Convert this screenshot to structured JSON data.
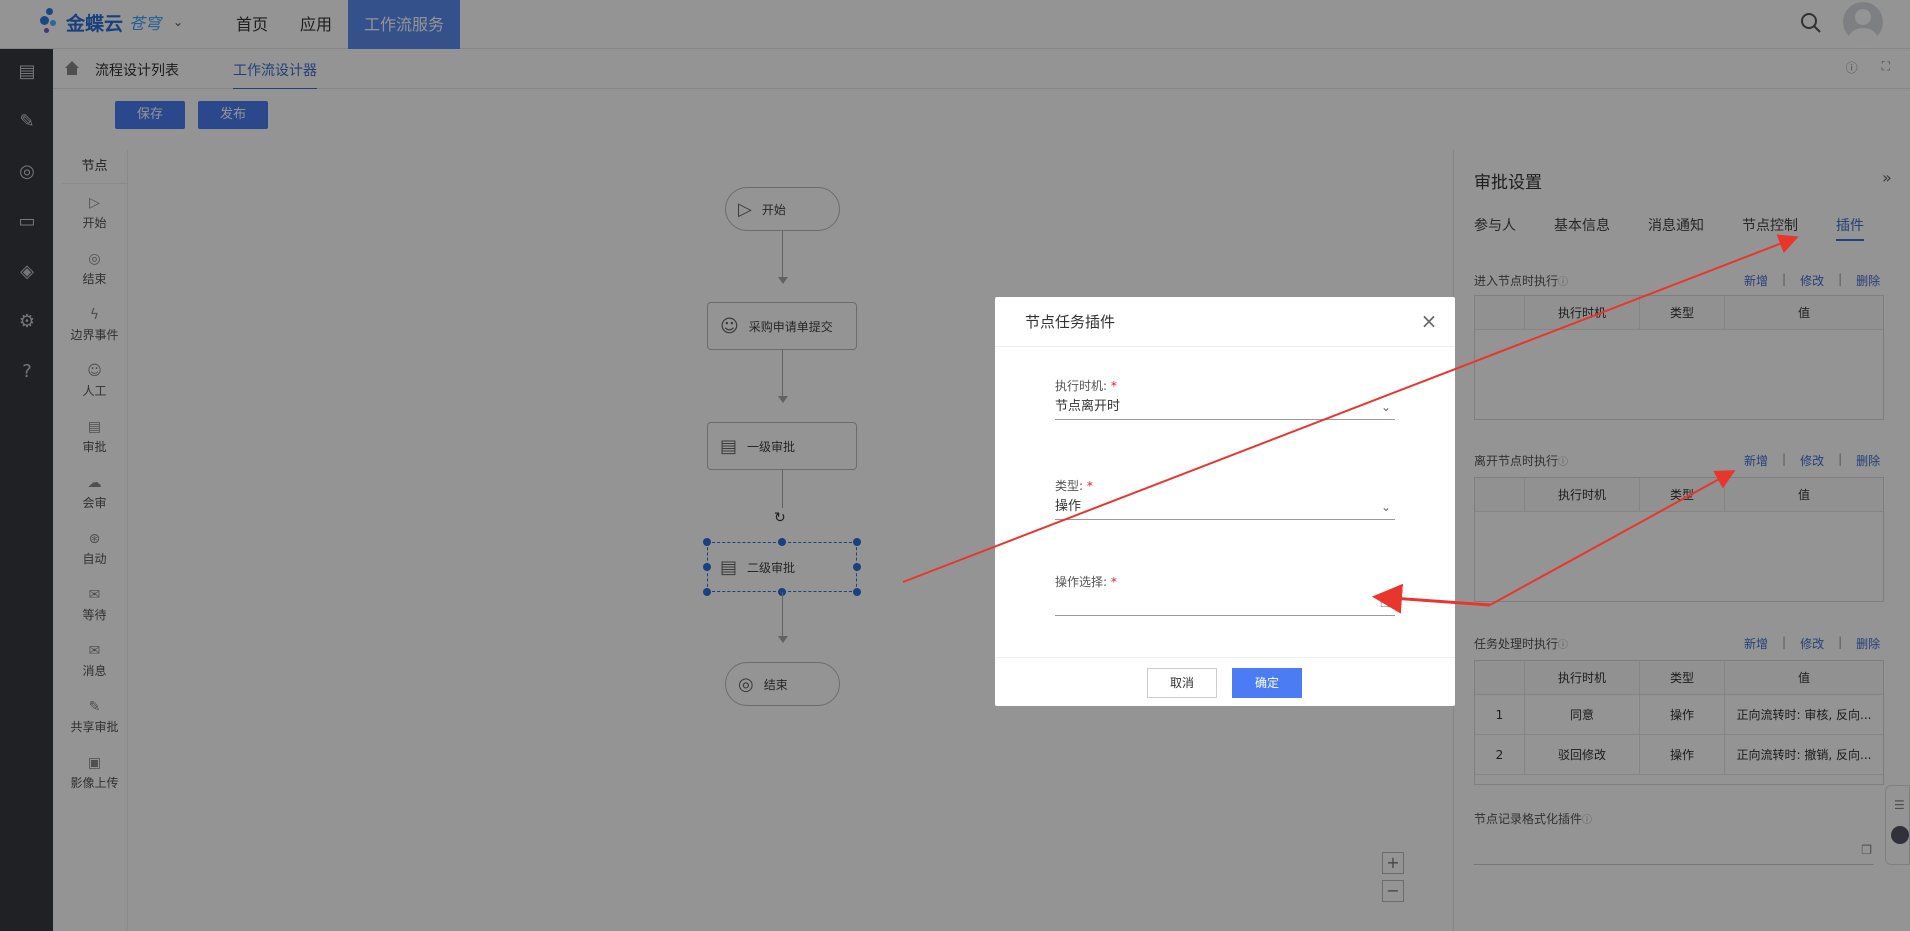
{
  "topbar": {
    "logo_text": "金蝶云",
    "logo_sub": "苍穹",
    "nav": [
      {
        "label": "首页"
      },
      {
        "label": "应用"
      },
      {
        "label": "工作流服务"
      }
    ]
  },
  "breadcrumb": {
    "items": [
      {
        "label": "流程设计列表"
      },
      {
        "label": "工作流设计器"
      }
    ]
  },
  "toolbar": {
    "save_label": "保存",
    "publish_label": "发布"
  },
  "palette": {
    "header": "节点",
    "items": [
      {
        "label": "开始",
        "icon": "play-circle-icon"
      },
      {
        "label": "结束",
        "icon": "stop-circle-icon"
      },
      {
        "label": "边界事件",
        "icon": "lightning-icon"
      },
      {
        "label": "人工",
        "icon": "person-icon"
      },
      {
        "label": "审批",
        "icon": "approval-doc-icon"
      },
      {
        "label": "会审",
        "icon": "cloud-icon"
      },
      {
        "label": "自动",
        "icon": "auto-icon"
      },
      {
        "label": "等待",
        "icon": "envelope-clock-icon"
      },
      {
        "label": "消息",
        "icon": "mail-icon"
      },
      {
        "label": "共享审批",
        "icon": "shared-doc-icon"
      },
      {
        "label": "影像上传",
        "icon": "image-icon"
      }
    ]
  },
  "flow": {
    "start": "开始",
    "submit": "采购申请单提交",
    "level1": "一级审批",
    "level2": "二级审批",
    "end": "结束"
  },
  "right_panel": {
    "title": "审批设置",
    "tabs": [
      "参与人",
      "基本信息",
      "消息通知",
      "节点控制",
      "插件"
    ],
    "active_tab": "插件",
    "actions": {
      "add": "新增",
      "edit": "修改",
      "delete": "删除",
      "sep": "|"
    },
    "sections": {
      "enter": {
        "title": "进入节点时执行"
      },
      "leave": {
        "title": "离开节点时执行"
      },
      "task": {
        "title": "任务处理时执行"
      },
      "record": {
        "title": "节点记录格式化插件"
      }
    },
    "columns": {
      "time": "执行时机",
      "type": "类型",
      "value": "值"
    },
    "task_rows": [
      {
        "idx": "1",
        "time": "同意",
        "type": "操作",
        "value": "正向流转时: 审核, 反向..."
      },
      {
        "idx": "2",
        "time": "驳回修改",
        "type": "操作",
        "value": "正向流转时: 撤销, 反向..."
      }
    ]
  },
  "dialog": {
    "title": "节点任务插件",
    "fields": {
      "timing": {
        "label": "执行时机:",
        "value": "节点离开时"
      },
      "type": {
        "label": "类型:",
        "value": "操作"
      },
      "operation": {
        "label": "操作选择:",
        "value": ""
      }
    },
    "required_mark": "*",
    "cancel_label": "取消",
    "ok_label": "确定"
  },
  "colors": {
    "primary": "#4b7cf3",
    "nav_active": "#5b8cf0",
    "rail": "#36393f",
    "annotation": "#e8362e",
    "link": "#3e6fd0"
  }
}
